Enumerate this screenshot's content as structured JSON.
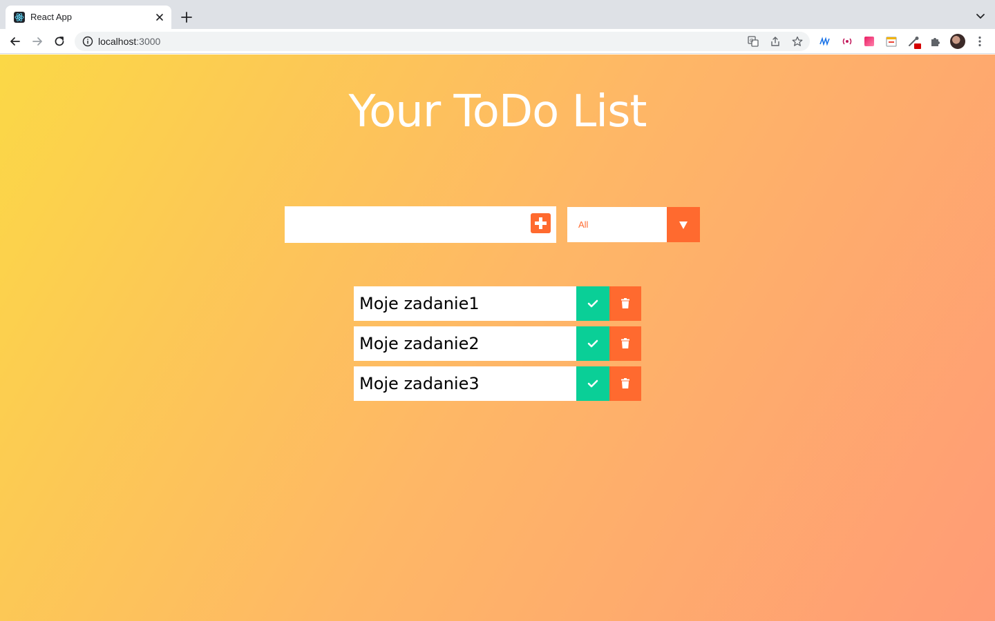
{
  "browser": {
    "tab_title": "React App",
    "url_host": "localhost",
    "url_port": ":3000",
    "extensions": [
      "translate-icon",
      "share-icon",
      "bookmark-star-icon",
      "extension-wave-icon",
      "extension-broadcast-icon",
      "extension-gradient-icon",
      "extension-calendar-icon",
      "extension-eyedropper-icon",
      "extensions-puzzle-icon"
    ]
  },
  "app": {
    "title": "Your ToDo List",
    "input": {
      "value": "",
      "placeholder": ""
    },
    "filter": {
      "selected": "All"
    },
    "todos": [
      {
        "text": "Moje zadanie1"
      },
      {
        "text": "Moje zadanie2"
      },
      {
        "text": "Moje zadanie3"
      }
    ]
  },
  "colors": {
    "accent": "#ff6a2f",
    "complete": "#0acf97",
    "gradient_start": "#fbd846",
    "gradient_end": "#ff9b76"
  }
}
